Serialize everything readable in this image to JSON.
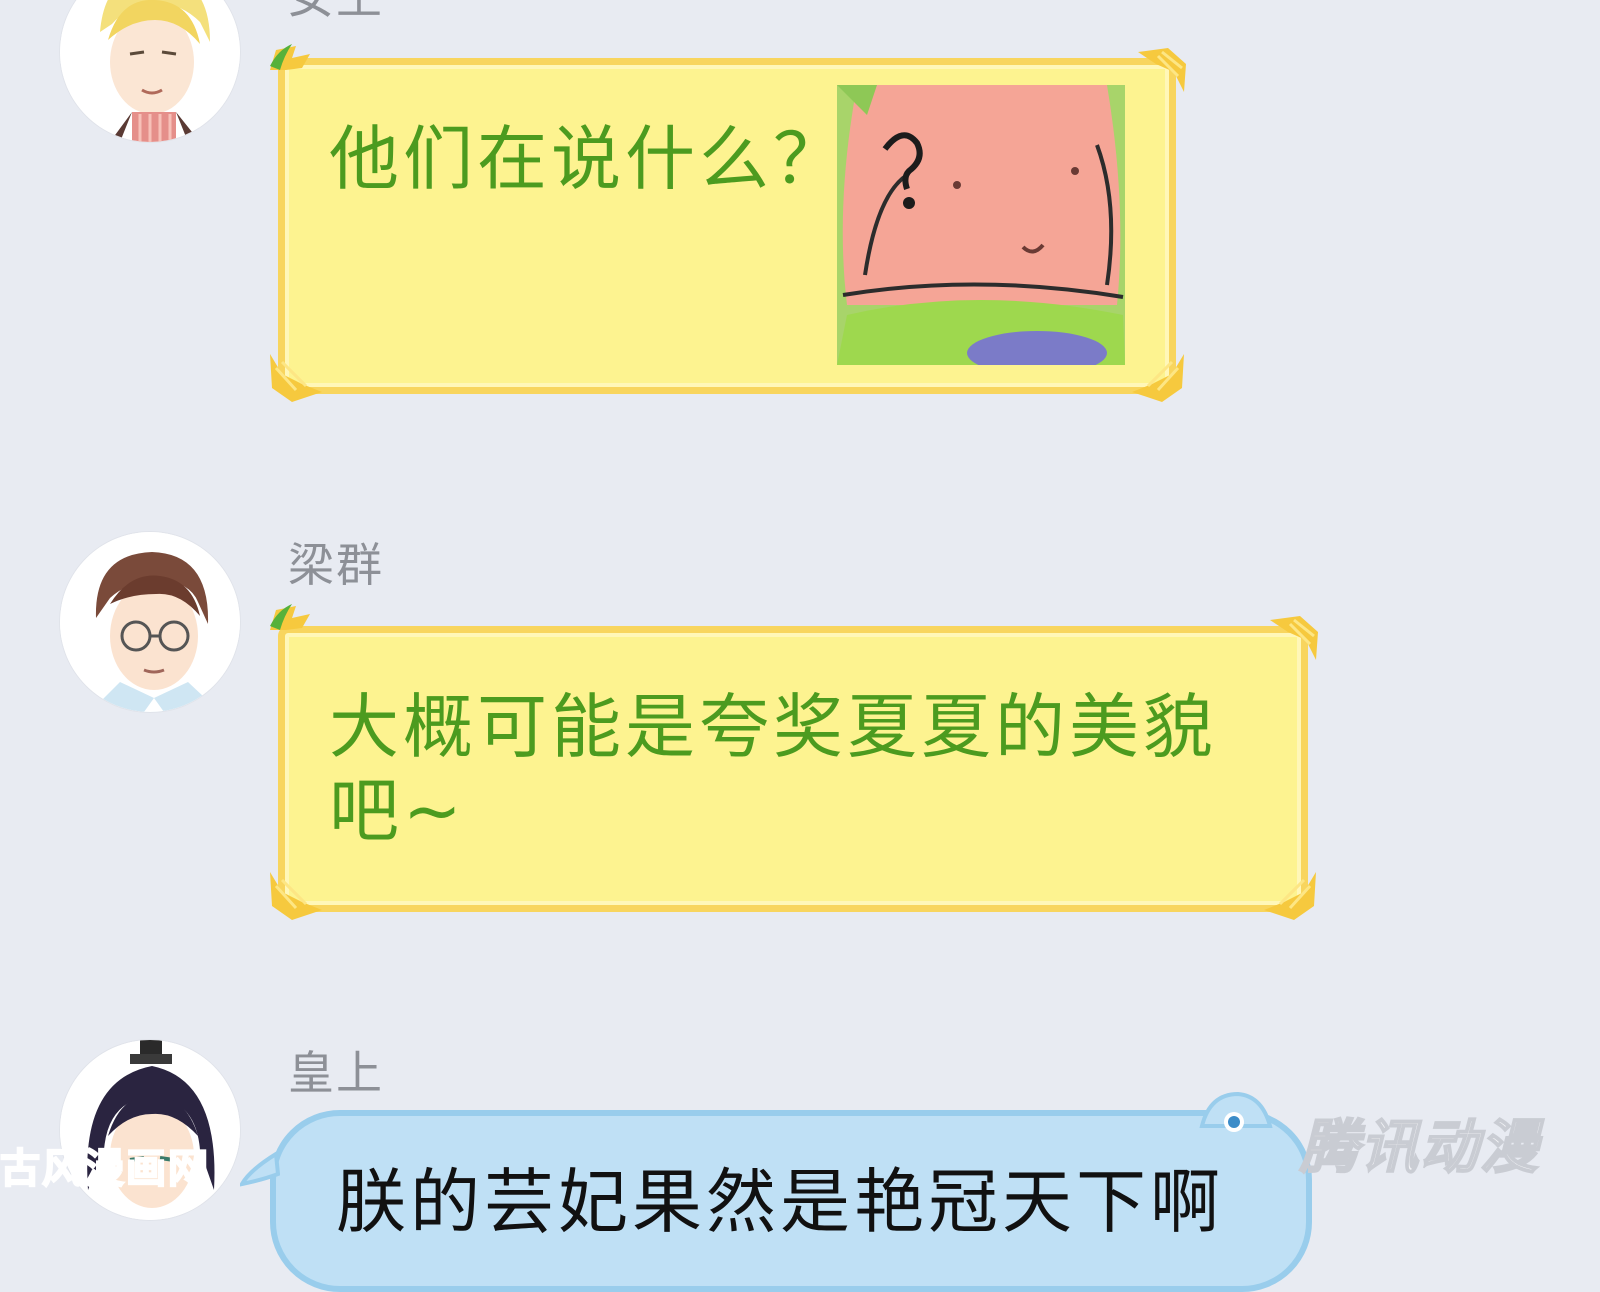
{
  "chat": {
    "messages": [
      {
        "sender": "女王",
        "text": "他们在说什么？",
        "bubble_style": "yellow",
        "sticker": "patrick-star-question-sticker"
      },
      {
        "sender": "梁群",
        "text": "大概可能是夸奖夏夏的美貌吧~",
        "bubble_style": "yellow"
      },
      {
        "sender": "皇上",
        "text": "朕的芸妃果然是艳冠天下啊",
        "bubble_style": "blue"
      }
    ]
  },
  "watermarks": {
    "left": "古风漫画网",
    "right": "腾讯动漫"
  },
  "colors": {
    "background": "#e8ebf2",
    "yellow_bubble": "#fdf390",
    "yellow_border": "#f8d55e",
    "bubble_text_green": "#4c9b1f",
    "blue_bubble": "#bfe0f5",
    "name_gray": "#8d9097"
  }
}
